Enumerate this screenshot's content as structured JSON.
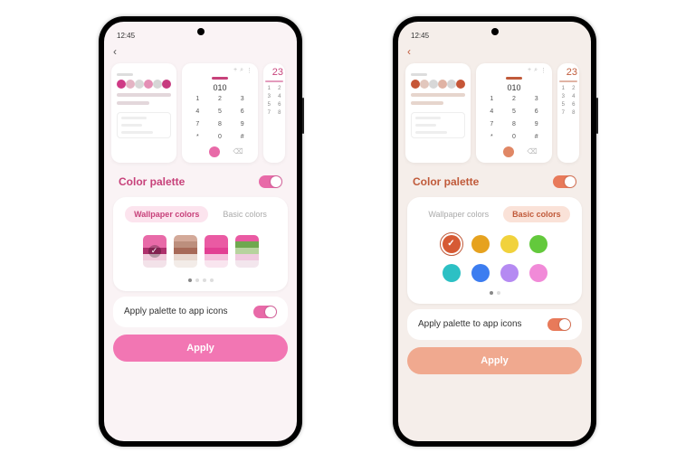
{
  "status_time": "12:45",
  "dialer_display": "010",
  "dial_keys": [
    "1",
    "2",
    "3",
    "4",
    "5",
    "6",
    "7",
    "8",
    "9",
    "*",
    "0",
    "#"
  ],
  "sliver_big": "23",
  "section_title": "Color palette",
  "tabs": {
    "wallpaper": "Wallpaper colors",
    "basic": "Basic colors"
  },
  "apply_icons_label": "Apply palette to app icons",
  "apply_button": "Apply",
  "phoneA": {
    "accent": "#c7417a",
    "icon_colors": [
      "#cf3a86",
      "#e4b4c4",
      "#d8d8d8",
      "#e48fb5",
      "#d6d6d6",
      "#c73b7f"
    ],
    "swatches": [
      {
        "selected": true,
        "stops": [
          "#e86aa8",
          "#e86aa8",
          "#ae2f6c",
          "#f1cbdc",
          "#f3e2e9"
        ]
      },
      {
        "selected": false,
        "stops": [
          "#d3a999",
          "#bc8f7d",
          "#a76a58",
          "#e9d9d0",
          "#f3ece8"
        ]
      },
      {
        "selected": false,
        "stops": [
          "#ea5aa3",
          "#ea5aa3",
          "#e23f93",
          "#f5c2dd",
          "#f9e5ef"
        ]
      },
      {
        "selected": false,
        "stops": [
          "#ea5aa3",
          "#6fa84f",
          "#b7d39e",
          "#f0cadf",
          "#f3e6ed"
        ]
      }
    ]
  },
  "phoneB": {
    "accent": "#c05a3a",
    "icon_colors": [
      "#c65637",
      "#e2c7bd",
      "#d8d8d8",
      "#e0b3a4",
      "#d6d6d6",
      "#c65637"
    ],
    "basic_colors": [
      {
        "color": "#d65a34",
        "selected": true
      },
      {
        "color": "#e6a21f",
        "selected": false
      },
      {
        "color": "#f1d23c",
        "selected": false
      },
      {
        "color": "#63c93c",
        "selected": false
      },
      {
        "color": "#2cc0c4",
        "selected": false
      },
      {
        "color": "#3c7df0",
        "selected": false
      },
      {
        "color": "#b58af2",
        "selected": false
      },
      {
        "color": "#f18ad8",
        "selected": false
      }
    ]
  }
}
